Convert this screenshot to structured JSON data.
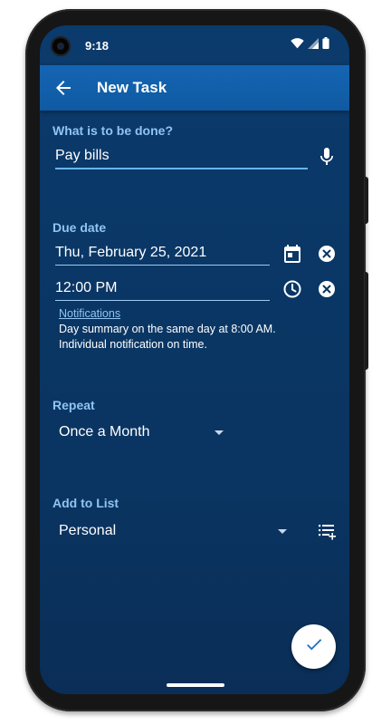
{
  "status_bar": {
    "time": "9:18"
  },
  "app_bar": {
    "title": "New Task"
  },
  "task": {
    "label": "What is to be done?",
    "value": "Pay bills"
  },
  "due_date": {
    "label": "Due date",
    "date": "Thu, February 25, 2021",
    "time": "12:00 PM",
    "notifications_link": "Notifications",
    "notification_lines": [
      "Day summary on the same day at 8:00 AM.",
      "Individual notification on time."
    ]
  },
  "repeat": {
    "label": "Repeat",
    "selected": "Once a Month"
  },
  "list": {
    "label": "Add to List",
    "selected": "Personal"
  },
  "colors": {
    "background": "#0a3461",
    "app_bar": "#1565b3",
    "label": "#90c4f2",
    "fab": "#ffffff",
    "fab_icon": "#1e6fc1"
  }
}
